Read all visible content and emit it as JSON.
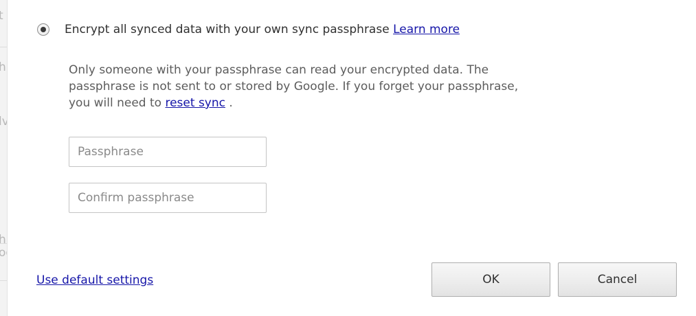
{
  "background_fragments": [
    "t",
    "h",
    "lv",
    "h",
    "og"
  ],
  "encrypt_option": {
    "label": "Encrypt all synced data with your own sync passphrase",
    "link": "Learn more",
    "selected": true
  },
  "description": {
    "line1": "Only someone with your passphrase can read your encrypted data. The",
    "line2": "passphrase is not sent to or stored by Google. If you forget your passphrase,",
    "line3_prefix": "you will need to",
    "reset_link": "reset sync",
    "line3_suffix": " ."
  },
  "passphrase_field": {
    "placeholder": "Passphrase",
    "value": ""
  },
  "confirm_field": {
    "placeholder": "Confirm passphrase",
    "value": ""
  },
  "default_settings_link": "Use default settings",
  "buttons": {
    "ok": "OK",
    "cancel": "Cancel"
  },
  "colors": {
    "link": "#1515a8",
    "text": "#303030",
    "description_text": "#5c5c5c",
    "button_border": "#adadad"
  }
}
